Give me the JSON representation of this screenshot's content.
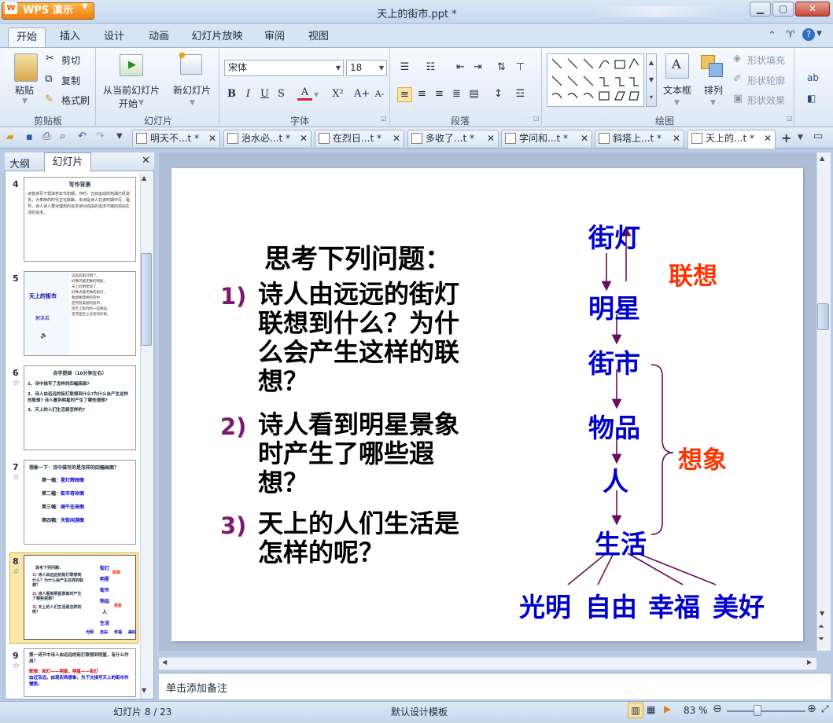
{
  "app": {
    "name": "WPS 演示",
    "logo": "W",
    "window_title": "天上的街市.ppt *"
  },
  "ribbon_tabs": [
    "开始",
    "插入",
    "设计",
    "动画",
    "幻灯片放映",
    "审阅",
    "视图"
  ],
  "clipboard": {
    "paste": "粘贴",
    "cut": "剪切",
    "copy": "复制",
    "format_painter": "格式刷",
    "group": "剪贴板"
  },
  "slides_group": {
    "from_current": "从当前幻灯片",
    "start": "开始",
    "new_slide": "新幻灯片",
    "group": "幻灯片"
  },
  "font_group": {
    "font_name": "宋体",
    "font_size": "18",
    "group": "字体",
    "bold": "B",
    "italic": "I",
    "underline": "U",
    "strike": "S",
    "color_a": "A",
    "superscript": "X²",
    "grow": "A+",
    "shrink": "A-"
  },
  "paragraph_group": {
    "group": "段落"
  },
  "drawing_group": {
    "textbox": "文本框",
    "arrange": "排列",
    "shape_fill": "形状填充",
    "shape_outline": "形状轮廓",
    "shape_effect": "形状效果",
    "group": "绘图"
  },
  "doc_tabs": [
    "明天不...t *",
    "治水必...t *",
    "在烈日...t *",
    "多收了...t *",
    "学问和...t *",
    "斜塔上...t *",
    "天上的...t *"
  ],
  "panel_tabs": {
    "outline": "大纲",
    "slides": "幻灯片"
  },
  "thumbnails": [
    {
      "num": "4",
      "title": "写作背景",
      "lines": [
        "诗首诗写于郭沫若年代初期，作时，五四运动的热潮已经退去，大革命的时代正在酝酿，本诗是诗人在该时期中写，倡导，诗人诗人要对理想的追求诗对自由的追求不做的自由生活的追求。"
      ],
      "star": false
    },
    {
      "num": "5",
      "title": "天上的街市",
      "sub": "郭沫若",
      "lines": [
        "远远的街灯明了，",
        "好像闪着无数的明星。",
        "天上的明星现了，",
        "好像点着无数的街灯。",
        "我想那缥缈的空中，",
        "定然有美丽的街市。",
        "街市上陈列的一些物品，",
        "定然是世上没有的珍奇。"
      ],
      "star": false
    },
    {
      "num": "6",
      "title": "自学提纲（10分钟左右）",
      "lines": [
        "1、诗中描写了怎样的四幅画面?",
        "2、诗人由远远的街灯联想到什么?为什么会产生这样的联想? 诗人看到明星时产生了哪些遐想?",
        "3、天上的人们生活是怎样的?"
      ],
      "star": true
    },
    {
      "num": "7",
      "title": "想象一下：诗中描写的是怎样的四幅画面？",
      "rows": [
        [
          "第一幅：",
          "星灯辉映图"
        ],
        [
          "第二幅：",
          "街市奇珍图"
        ],
        [
          "第三幅：",
          "骑牛往来图"
        ],
        [
          "第四幅：",
          "天街闲游图"
        ]
      ],
      "star": true
    },
    {
      "num": "8",
      "star": true
    },
    {
      "num": "9",
      "title": "第一诗节中诗人由远远的街灯联想到明星，有什么作用？",
      "lines": [
        "联想：街灯——明星，明星——街灯",
        "由近及远，由现实到想象，为下文描写天上的街市作铺垫。"
      ],
      "star": true
    }
  ],
  "slide": {
    "question_title": "思考下列问题：",
    "questions": [
      {
        "n": "1)",
        "lines": [
          "诗人由远远的街灯",
          "联想到什么？为什",
          "么会产生这样的联",
          "想？"
        ]
      },
      {
        "n": "2)",
        "lines": [
          "诗人看到明星景象",
          "时产生了哪些遐",
          "想？"
        ]
      },
      {
        "n": "3)",
        "lines": [
          "天上的人们生活是",
          "怎样的呢？"
        ]
      }
    ],
    "diagram": {
      "nodes": [
        "街灯",
        "明星",
        "街市",
        "物品",
        "人",
        "生活"
      ],
      "leaves": [
        "光明",
        "自由",
        "幸福",
        "美好"
      ],
      "label_lianxiang": "联想",
      "label_xiangxiang": "想象"
    },
    "colors": {
      "number": "#7b1a6e",
      "text": "#000000",
      "node": "#0000cc",
      "label": "#ff3300",
      "line": "#6a0d5e"
    }
  },
  "notes_placeholder": "单击添加备注",
  "status": {
    "slide_counter": "幻灯片 8 / 23",
    "template": "默认设计模板",
    "zoom": "83 %"
  }
}
